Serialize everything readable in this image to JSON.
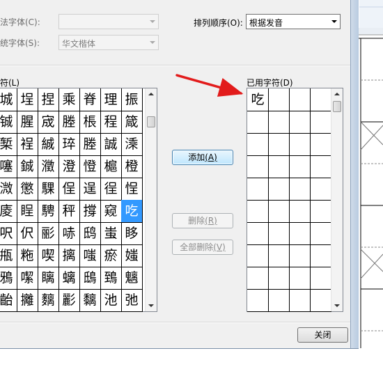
{
  "labels": {
    "font_label": "法字体(C):",
    "style_font_label": "统字体(S):",
    "sort_label": "排列顺序(O):",
    "chars_label": "符(L)",
    "used_label": "已用字符(D)"
  },
  "fields": {
    "font_value": "",
    "style_font_value": "华文楷体",
    "sort_value": "根据发音"
  },
  "grid_chars": [
    [
      "城",
      "埕",
      "捏",
      "乘",
      "脊",
      "理",
      "振"
    ],
    [
      "铖",
      "腥",
      "宬",
      "塍",
      "棖",
      "程",
      "箴"
    ],
    [
      "椠",
      "裎",
      "絾",
      "琗",
      "塍",
      "誠",
      "溗"
    ],
    [
      "噻",
      "鋮",
      "瀓",
      "澄",
      "憕",
      "槴",
      "橙"
    ],
    [
      "溦",
      "懲",
      "騍",
      "侱",
      "逞",
      "徎",
      "悜"
    ],
    [
      "庱",
      "睈",
      "騁",
      "秤",
      "撐",
      "窥",
      "吃"
    ],
    [
      "呎",
      "伬",
      "彨",
      "哧",
      "鸱",
      "蚩",
      "眵"
    ],
    [
      "甁",
      "粚",
      "喫",
      "摛",
      "嗤",
      "瘀",
      "媸"
    ],
    [
      "鴉",
      "噄",
      "瞝",
      "螭",
      "鴟",
      "鵄",
      "魑"
    ],
    [
      "齝",
      "攡",
      "麶",
      "彲",
      "黐",
      "池",
      "弛"
    ]
  ],
  "selected_char": "吃",
  "used_chars": [
    "吃"
  ],
  "buttons": {
    "add": "添加",
    "add_key": "(A)",
    "delete": "删除",
    "delete_key": "(R)",
    "delete_all": "全部删除",
    "delete_all_key": "(V)",
    "close": "关闭"
  },
  "colors": {
    "selection": "#3399ff",
    "arrow": "#e21b1b"
  }
}
